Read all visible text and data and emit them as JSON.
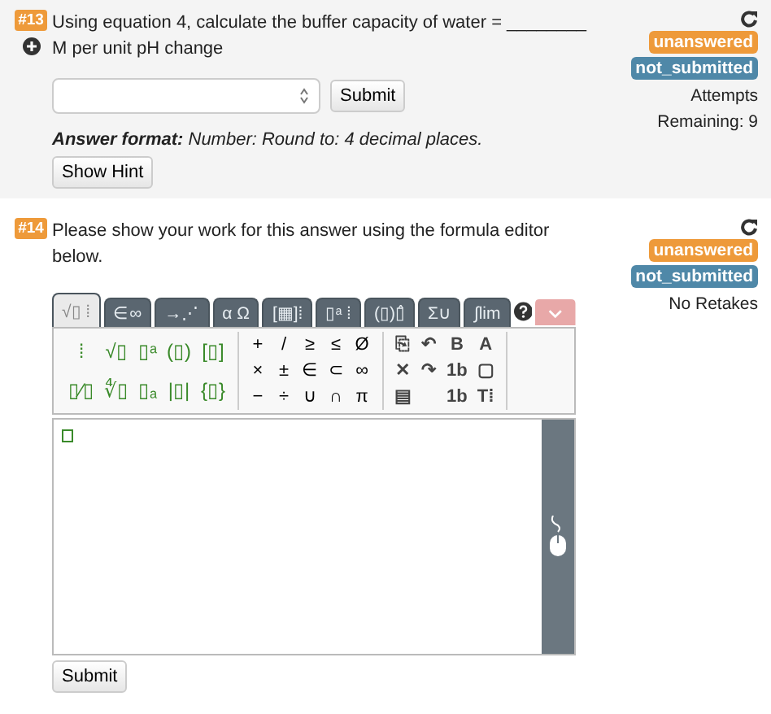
{
  "questions": [
    {
      "kind": "numeric",
      "number": "#13",
      "text": "Using equation 4, calculate the buffer capacity of water = ________ M per unit pH change",
      "badges": [
        {
          "text": "unanswered",
          "color": "#ee9a3a"
        },
        {
          "text": "not_submitted",
          "color": "#4f88a8"
        }
      ],
      "note": "Attempts Remaining: 9",
      "submit": "Submit",
      "answer_format": "**Answer format:** Number: Round to: 4 decimal places.",
      "hint_button": "Show Hint"
    },
    {
      "kind": "formula",
      "number": "#14",
      "text": "Please show your work for this answer using the formula editor below.",
      "badges": [
        {
          "text": "unanswered",
          "color": "#ee9a3a"
        },
        {
          "text": "not_submitted",
          "color": "#4f88a8"
        }
      ],
      "note": "No Retakes",
      "submit": "Submit",
      "editor": {
        "tabs": [
          {
            "label": "√▯ ⁞",
            "selected": true
          },
          {
            "label": "∈∞",
            "selected": false
          },
          {
            "label": "→⋰",
            "selected": false
          },
          {
            "label": "α Ω",
            "selected": false
          },
          {
            "label": "[▦]⁞",
            "selected": false
          },
          {
            "label": "▯ᵃ ⁞",
            "selected": false
          },
          {
            "label": "(▯)▯̂",
            "selected": false
          },
          {
            "label": "Σ∪",
            "selected": false
          },
          {
            "label": "∫lim",
            "selected": false
          }
        ],
        "groups": [
          {
            "kind": "template",
            "cells": [
              "⁞",
              "√▯",
              "▯ᵃ",
              "(▯)",
              "[▯]",
              "▯⁄▯",
              "∜▯",
              "▯ₐ",
              "|▯|",
              "{▯}"
            ]
          },
          {
            "kind": "symbol",
            "cells": [
              "+",
              "/",
              "≥",
              "≤",
              "Ø",
              "×",
              "±",
              "∈",
              "⊂",
              "∞",
              "−",
              "÷",
              "∪",
              "∩",
              "π"
            ]
          },
          {
            "kind": "style",
            "cells": [
              "⎘",
              "↶",
              "B",
              "A",
              "✕",
              "↷",
              "1b",
              "▢",
              "▤",
              "",
              "1b",
              "T⁞"
            ]
          }
        ]
      }
    }
  ]
}
